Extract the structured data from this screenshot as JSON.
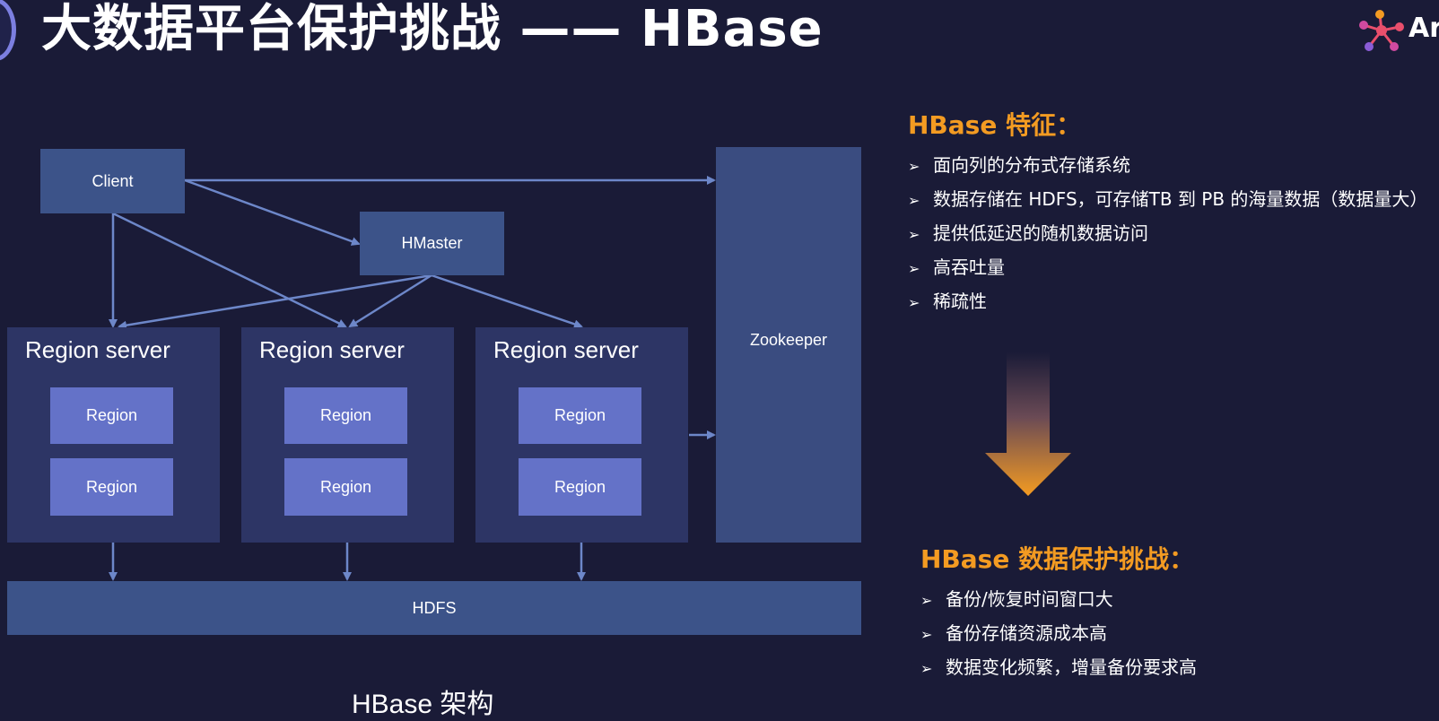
{
  "header": {
    "title": "大数据平台保护挑战 —— HBase",
    "brand": "Ar"
  },
  "diagram": {
    "client": "Client",
    "hmaster": "HMaster",
    "zookeeper": "Zookeeper",
    "hdfs": "HDFS",
    "region_servers": [
      {
        "label": "Region server",
        "regions": [
          "Region",
          "Region"
        ]
      },
      {
        "label": "Region server",
        "regions": [
          "Region",
          "Region"
        ]
      },
      {
        "label": "Region server",
        "regions": [
          "Region",
          "Region"
        ]
      }
    ],
    "caption": "HBase 架构"
  },
  "features": {
    "title": "HBase 特征：",
    "items": [
      "面向列的分布式存储系统",
      "数据存储在 HDFS，可存储TB 到 PB 的海量数据（数据量大）",
      "提供低延迟的随机数据访问",
      "高吞吐量",
      "稀疏性"
    ]
  },
  "challenges": {
    "title": "HBase 数据保护挑战：",
    "items": [
      "备份/恢复时间窗口大",
      "备份存储资源成本高",
      "数据变化频繁，增量备份要求高"
    ]
  },
  "colors": {
    "background": "#1a1b37",
    "accent": "#f39b22",
    "node": "#3c5389",
    "region": "#6472c8",
    "arrow": "#6d87c9"
  }
}
